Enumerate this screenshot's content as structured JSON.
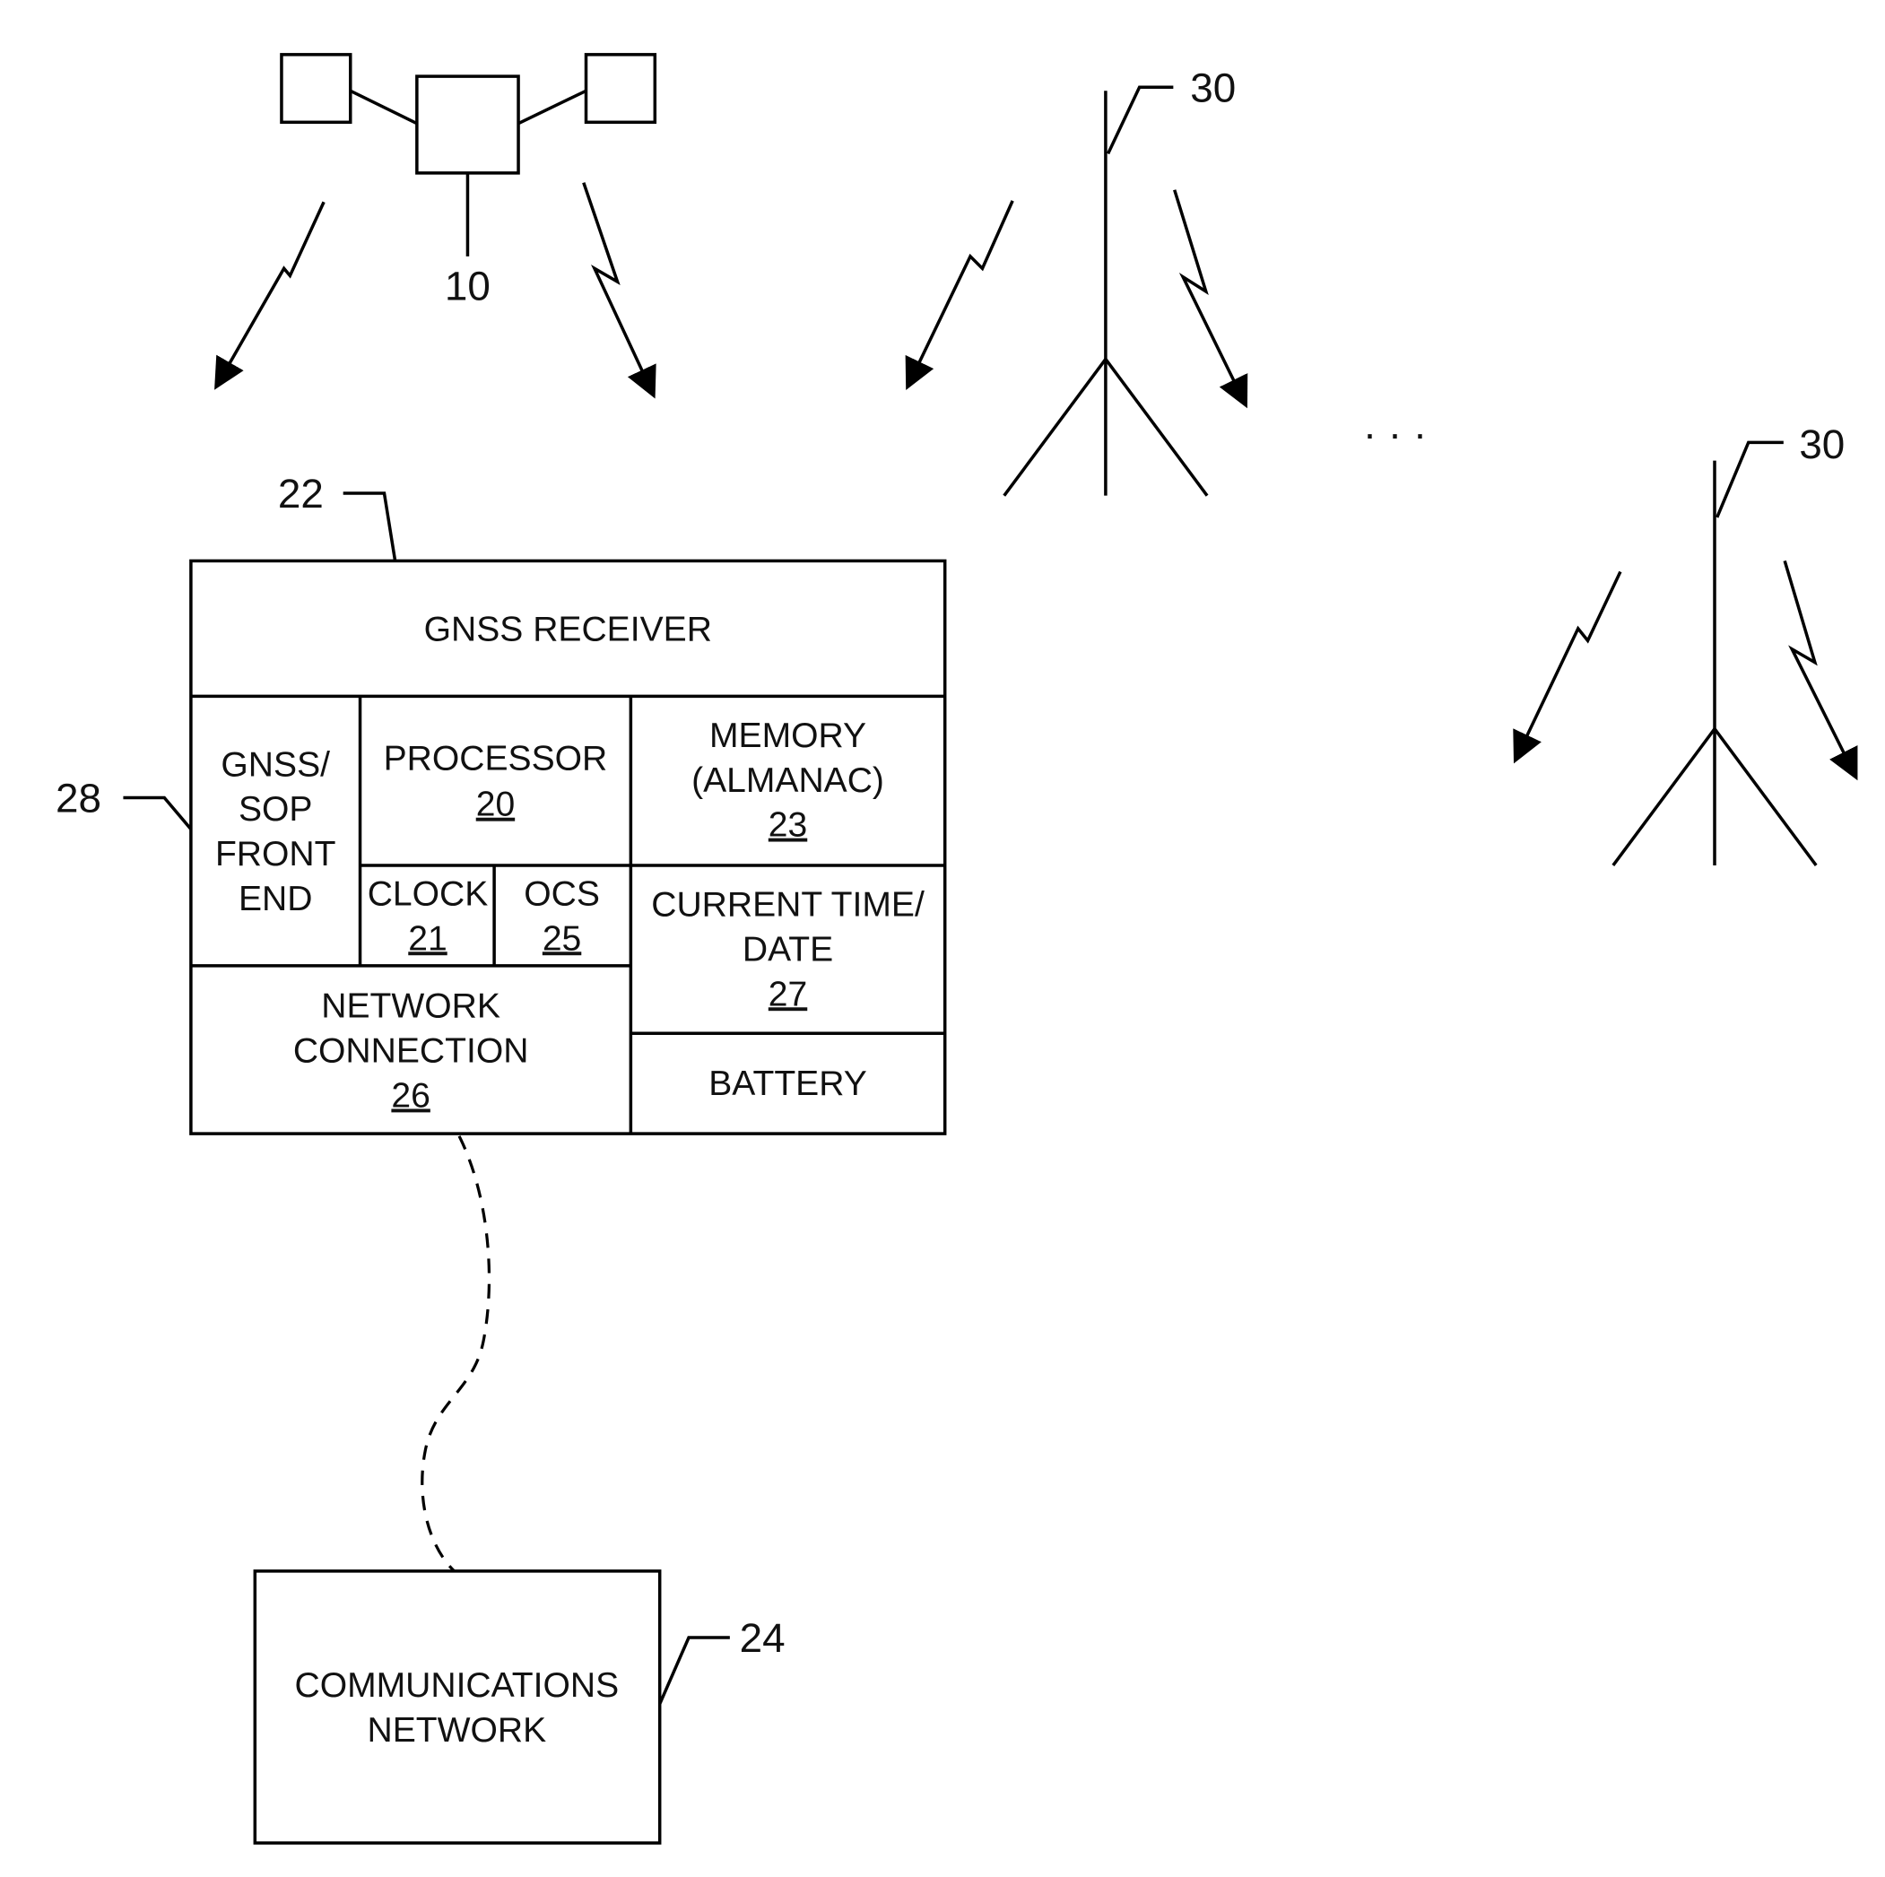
{
  "satellite": {
    "ref": "10"
  },
  "towers": [
    {
      "ref": "30"
    },
    {
      "ref": "30"
    }
  ],
  "ellipsis": "· · ·",
  "receiver": {
    "ref": "22",
    "title": "GNSS RECEIVER",
    "front_end": {
      "ref": "28",
      "lines": [
        "GNSS/",
        "SOP",
        "FRONT",
        "END"
      ]
    },
    "processor": {
      "label": "PROCESSOR",
      "num": "20"
    },
    "memory": {
      "lines": [
        "MEMORY",
        "(ALMANAC)"
      ],
      "num": "23"
    },
    "clock": {
      "label": "CLOCK",
      "num": "21"
    },
    "ocs": {
      "label": "OCS",
      "num": "25"
    },
    "current_time": {
      "lines": [
        "CURRENT TIME/",
        "DATE"
      ],
      "num": "27"
    },
    "network_connection": {
      "lines": [
        "NETWORK",
        "CONNECTION"
      ],
      "num": "26"
    },
    "battery": {
      "label": "BATTERY"
    }
  },
  "comm_network": {
    "ref": "24",
    "lines": [
      "COMMUNICATIONS",
      "NETWORK"
    ]
  }
}
